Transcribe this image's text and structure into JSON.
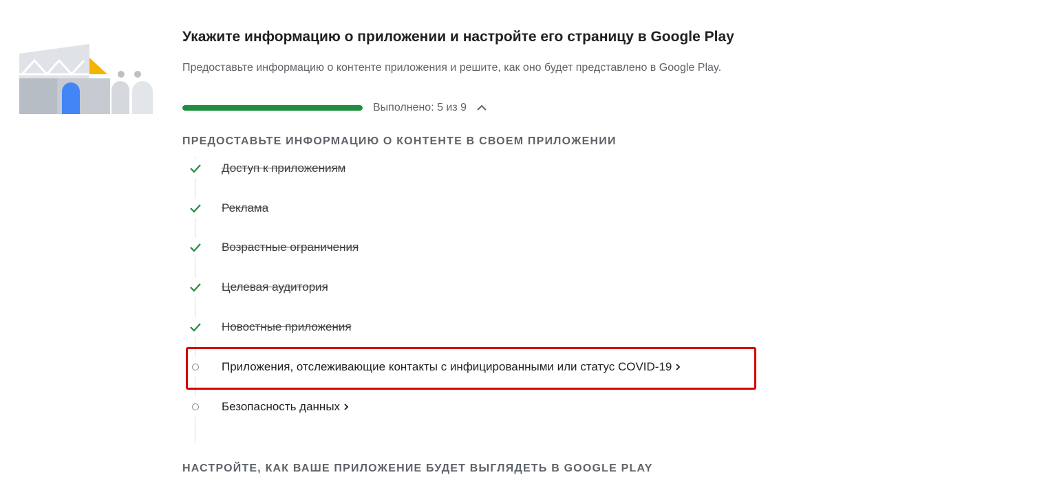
{
  "header": {
    "title": "Укажите информацию о приложении и настройте его страницу в Google Play",
    "subtitle": "Предоставьте информацию о контенте приложения и решите, как оно будет представлено в Google Play."
  },
  "progress": {
    "label": "Выполнено: 5 из 9",
    "completed": 5,
    "total": 9,
    "bar_fraction": 1.0,
    "bar_color": "#1e8e3e"
  },
  "sections": [
    {
      "heading": "ПРЕДОСТАВЬТЕ ИНФОРМАЦИЮ О КОНТЕНТЕ В СВОЕМ ПРИЛОЖЕНИИ",
      "tasks": [
        {
          "label": "Доступ к приложениям",
          "status": "done"
        },
        {
          "label": "Реклама",
          "status": "done"
        },
        {
          "label": "Возрастные ограничения",
          "status": "done"
        },
        {
          "label": "Целевая аудитория",
          "status": "done"
        },
        {
          "label": "Новостные приложения",
          "status": "done"
        },
        {
          "label": "Приложения, отслеживающие контакты с инфицированными или статус COVID-19",
          "status": "pending",
          "highlighted": true
        },
        {
          "label": "Безопасность данных",
          "status": "pending"
        }
      ]
    },
    {
      "heading": "НАСТРОЙТЕ, КАК ВАШЕ ПРИЛОЖЕНИЕ БУДЕТ ВЫГЛЯДЕТЬ В GOOGLE PLAY"
    }
  ],
  "icons": {
    "done": "check-icon",
    "pending": "circle-icon",
    "expand": "chevron-up-icon",
    "open": "chevron-right-icon"
  },
  "colors": {
    "check": "#1e8e3e",
    "highlight_border": "#d50000",
    "secondary_text": "#5f6368"
  }
}
